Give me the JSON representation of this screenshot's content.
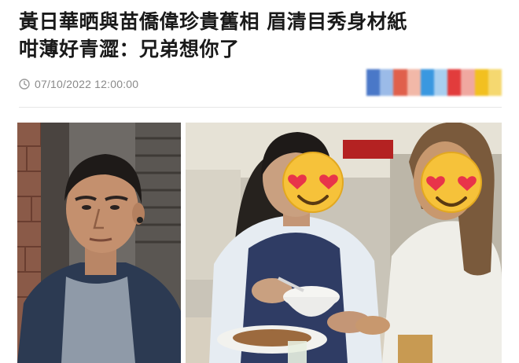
{
  "article": {
    "headline_line1": "黃日華晒與苗僑偉珍貴舊相 眉清目秀身材紙",
    "headline_line2": "咁薄好青澀：兄弟想你了",
    "date": "07/10/2022 12:00:00"
  },
  "icons": {
    "clock": "clock-icon"
  },
  "colors": {
    "headline": "#1a1a1a",
    "date": "#8a8a8a",
    "share_blur": [
      "#4a78c8",
      "#88b0e8",
      "#e0604c",
      "#f2b8a8",
      "#3a98e0",
      "#a8cff0",
      "#e23c3c",
      "#f0a8a0",
      "#f2c020",
      "#f5d870"
    ]
  },
  "images": {
    "left_photo": "man-in-dark-jacket",
    "right_photo": "two-young-men-at-table-with-emoji-faces",
    "emoji": "heart-eyes-emoji"
  }
}
